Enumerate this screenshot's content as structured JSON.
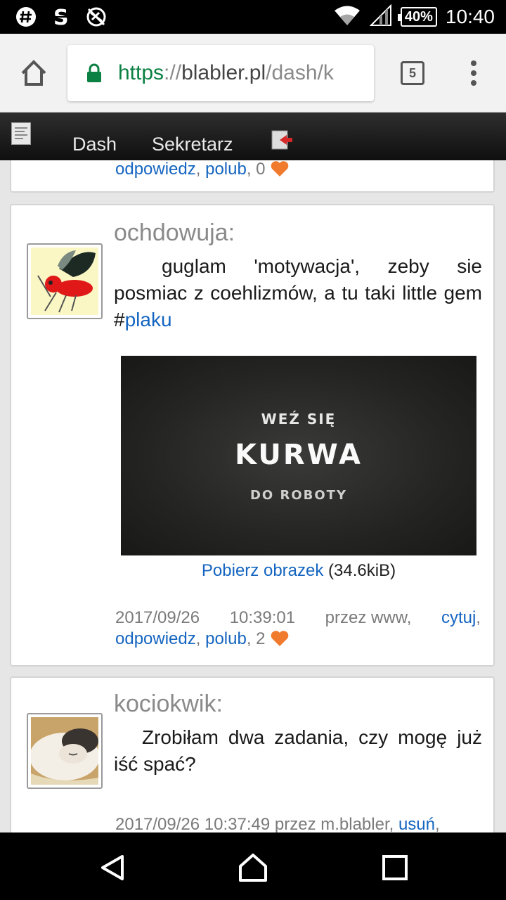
{
  "status_bar": {
    "battery": "40%",
    "time": "10:40",
    "icons": [
      "hash-notification-icon",
      "s-app-icon",
      "blocked-globe-icon",
      "wifi-icon",
      "signal-icon",
      "battery-icon"
    ]
  },
  "browser": {
    "url_scheme": "https",
    "url_sep": "://",
    "url_host": "blabler.pl",
    "url_path": "/dash/k",
    "tab_count": "5"
  },
  "navbar": {
    "dash": "Dash",
    "sekretarz": "Sekretarz"
  },
  "posts": [
    {
      "reply": "odpowiedz",
      "like": "polub",
      "likes": "0"
    },
    {
      "author": "ochdowuja:",
      "text_before": "guglam 'motywacja', zeby sie posmiac z coehlizmów, a tu taki little gem #",
      "tag": "plaku",
      "image_line1": "WEŹ SIĘ",
      "image_line2": "KURWA",
      "image_line3": "DO ROBOTY",
      "download_link": "Pobierz obrazek",
      "download_size": "(34.6kiB)",
      "date": "2017/09/26",
      "time": "10:39:01",
      "via": "przez www,",
      "quote": "cytuj",
      "reply": "odpowiedz",
      "like": "polub",
      "likes": "2"
    },
    {
      "author": "kociokwik:",
      "text": "Zrobiłam dwa zadania, czy mogę już iść spać?",
      "meta": "2017/09/26 10:37:49 przez m.blabler,",
      "delete": "usuń"
    }
  ],
  "colors": {
    "link": "#1565c0",
    "heart": "#f07a2e",
    "https_green": "#0b8043"
  }
}
